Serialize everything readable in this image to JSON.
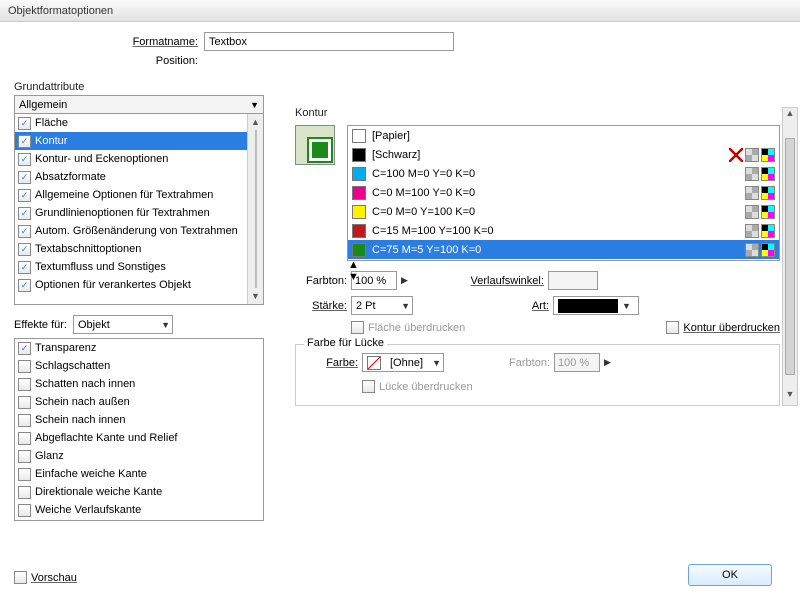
{
  "title": "Objektformatoptionen",
  "formatname_label": "Formatname:",
  "formatname_value": "Textbox",
  "position_label": "Position:",
  "grund_title": "Grundattribute",
  "allgemein_dd": "Allgemein",
  "grund_items": [
    {
      "label": "Fläche",
      "on": true,
      "sel": false
    },
    {
      "label": "Kontur",
      "on": true,
      "sel": true
    },
    {
      "label": "Kontur- und Eckenoptionen",
      "on": true,
      "sel": false
    },
    {
      "label": "Absatzformate",
      "on": true,
      "sel": false
    },
    {
      "label": "Allgemeine Optionen für Textrahmen",
      "on": true,
      "sel": false
    },
    {
      "label": "Grundlinienoptionen für Textrahmen",
      "on": true,
      "sel": false
    },
    {
      "label": "Autom. Größenänderung von Textrahmen",
      "on": true,
      "sel": false
    },
    {
      "label": "Textabschnittoptionen",
      "on": true,
      "sel": false
    },
    {
      "label": "Textumfluss und Sonstiges",
      "on": true,
      "sel": false
    },
    {
      "label": "Optionen für verankertes Objekt",
      "on": true,
      "sel": false
    }
  ],
  "effects_label": "Effekte für:",
  "effects_value": "Objekt",
  "effects_items": [
    {
      "label": "Transparenz",
      "on": true
    },
    {
      "label": "Schlagschatten",
      "on": false
    },
    {
      "label": "Schatten nach innen",
      "on": false
    },
    {
      "label": "Schein nach außen",
      "on": false
    },
    {
      "label": "Schein nach innen",
      "on": false
    },
    {
      "label": "Abgeflachte Kante und Relief",
      "on": false
    },
    {
      "label": "Glanz",
      "on": false
    },
    {
      "label": "Einfache weiche Kante",
      "on": false
    },
    {
      "label": "Direktionale weiche Kante",
      "on": false
    },
    {
      "label": "Weiche Verlaufskante",
      "on": false
    }
  ],
  "kontur_title": "Kontur",
  "colors": [
    {
      "label": "[Papier]",
      "bg": "#ffffff",
      "sel": false,
      "icons": [
        "",
        "",
        ""
      ]
    },
    {
      "label": "[Schwarz]",
      "bg": "#000000",
      "sel": false,
      "icons": [
        "x",
        "grey",
        "cmyk"
      ]
    },
    {
      "label": "C=100 M=0 Y=0 K=0",
      "bg": "#00aeef",
      "sel": false,
      "icons": [
        "",
        "grey",
        "cmyk"
      ]
    },
    {
      "label": "C=0 M=100 Y=0 K=0",
      "bg": "#ec008c",
      "sel": false,
      "icons": [
        "",
        "grey",
        "cmyk"
      ]
    },
    {
      "label": "C=0 M=0 Y=100 K=0",
      "bg": "#fff200",
      "sel": false,
      "icons": [
        "",
        "grey",
        "cmyk"
      ]
    },
    {
      "label": "C=15 M=100 Y=100 K=0",
      "bg": "#c4161c",
      "sel": false,
      "icons": [
        "",
        "grey",
        "cmyk"
      ]
    },
    {
      "label": "C=75 M=5 Y=100 K=0",
      "bg": "#1a8a1a",
      "sel": true,
      "icons": [
        "",
        "grey",
        "cmyk"
      ]
    }
  ],
  "farbton_label": "Farbton:",
  "farbton_value": "100 %",
  "staerke_label": "Stärke:",
  "staerke_value": "2 Pt",
  "verlaufswinkel_label": "Verlaufswinkel:",
  "art_label": "Art:",
  "flaeche_ueber": "Fläche überdrucken",
  "kontur_ueber": "Kontur überdrucken",
  "gap_title": "Farbe für Lücke",
  "gap_farbe_label": "Farbe:",
  "gap_farbe_value": "[Ohne]",
  "gap_farbton_label": "Farbton:",
  "gap_farbton_value": "100 %",
  "gap_lueck": "Lücke überdrucken",
  "preview_label": "Vorschau",
  "ok_label": "OK"
}
